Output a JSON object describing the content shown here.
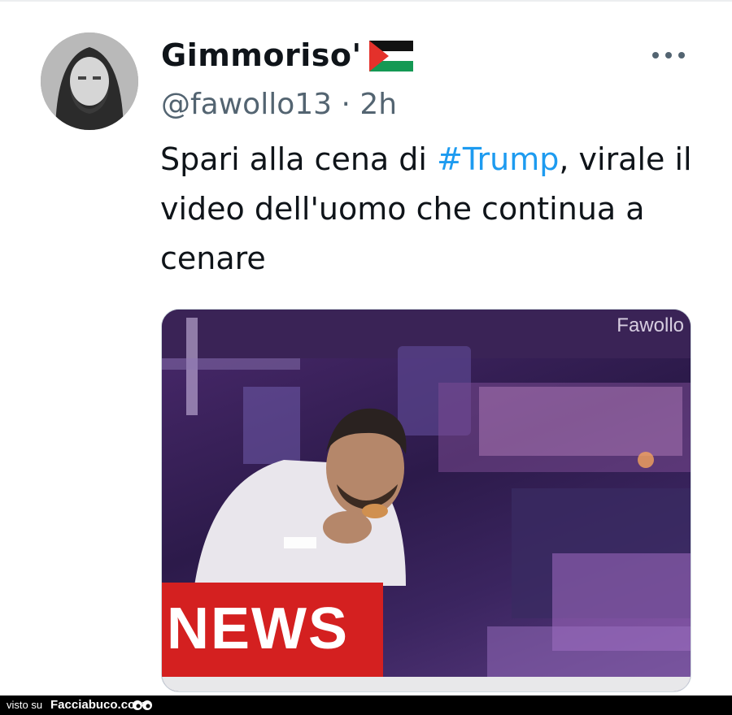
{
  "tweet": {
    "author_name": "Gimmoriso'",
    "handle": "@fawollo13",
    "separator": "·",
    "time": "2h",
    "text_before": "Spari alla cena di ",
    "hashtag": "#Trump",
    "text_after": ", virale il video dell'uomo che continua a cenare"
  },
  "media": {
    "watermark": "Fawollo",
    "banner_text": "NEWS"
  },
  "footer": {
    "prefix": "visto su",
    "site": "Facciabuco.com"
  },
  "icons": {
    "author_flag": "palestine-flag-icon",
    "more": "more-options-icon",
    "footer_logo": "eyes-logo-icon"
  },
  "colors": {
    "hashtag": "#1d9bf0",
    "handle": "#536471",
    "text": "#0f1419",
    "news_banner": "#d42020",
    "footer_bg": "#000000"
  }
}
